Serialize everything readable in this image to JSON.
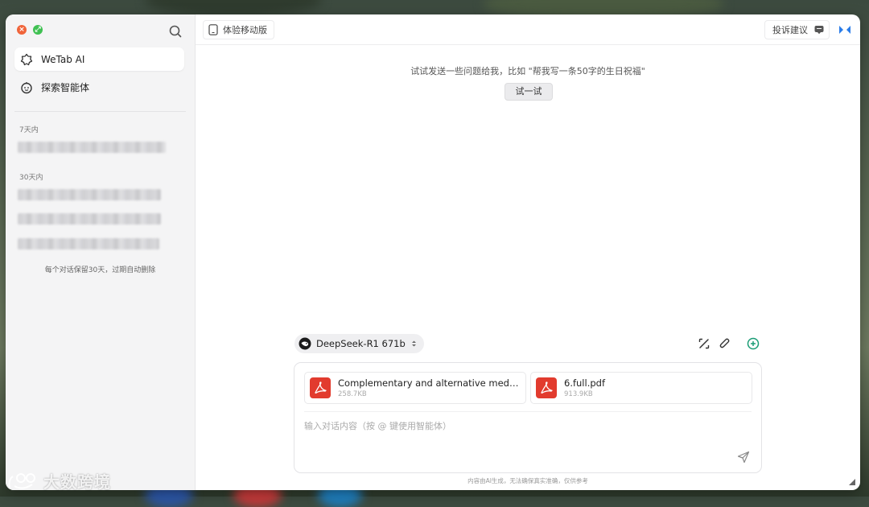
{
  "sidebar": {
    "nav": [
      {
        "label": "WeTab AI",
        "icon": "ai-logo-icon"
      },
      {
        "label": "探索智能体",
        "icon": "agent-icon"
      }
    ],
    "sections": [
      {
        "label": "7天内"
      },
      {
        "label": "30天内"
      }
    ],
    "retention_note": "每个对话保留30天，过期自动删除"
  },
  "topbar": {
    "mobile_label": "体验移动版",
    "feedback_label": "投诉建议"
  },
  "main": {
    "prompt_hint": "试试发送一些问题给我，比如 \"帮我写一条50字的生日祝福\"",
    "try_label": "试一试"
  },
  "composer": {
    "model": "DeepSeek-R1 671b",
    "files": [
      {
        "name": "Complementary and alternative medicine u...",
        "size": "258.7KB",
        "type": "pdf"
      },
      {
        "name": "6.full.pdf",
        "size": "913.9KB",
        "type": "pdf"
      }
    ],
    "placeholder": "输入对话内容（按 @ 键使用智能体）"
  },
  "disclaimer": "内容由AI生成，无法确保真实准确，仅供参考",
  "watermark": "大数跨境",
  "colors": {
    "accent_green": "#1a9c75",
    "pdf_red": "#e23b2e",
    "close_red": "#f0643a",
    "max_green": "#3fc052",
    "collapse_blue": "#2b7de9"
  }
}
